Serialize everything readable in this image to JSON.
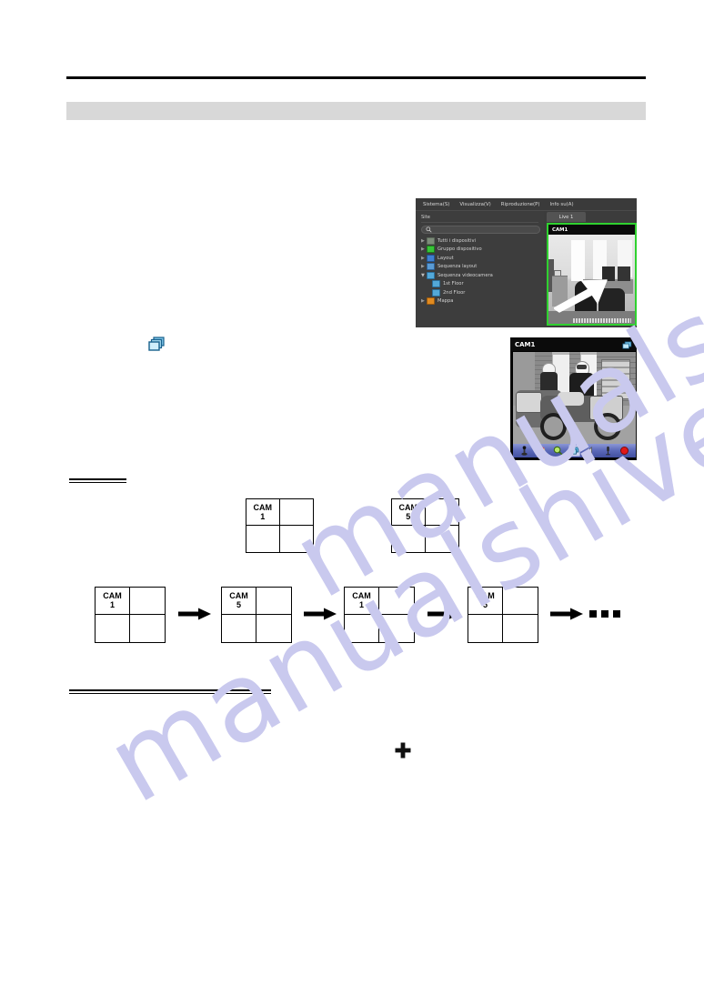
{
  "page": {
    "background": "#ffffff",
    "watermark_text": "manualshive.com",
    "watermark_color": "#c9c9ee"
  },
  "vms_window": {
    "menu": [
      {
        "label": "Sistema(S)"
      },
      {
        "label": "Visualizza(V)"
      },
      {
        "label": "Riproduzione(P)"
      },
      {
        "label": "Info su(A)"
      }
    ],
    "sidebar": {
      "title": "Site",
      "search_placeholder": "",
      "search_icon": "search-icon",
      "tree": [
        {
          "label": "Tutti i dispositivi",
          "icon": "devices-icon",
          "expander": "collapsed",
          "indent": 0
        },
        {
          "label": "Gruppo dispositivo",
          "icon": "device-group-icon",
          "expander": "collapsed",
          "indent": 0
        },
        {
          "label": "Layout",
          "icon": "layout-icon",
          "expander": "collapsed",
          "indent": 0
        },
        {
          "label": "Sequenza layout",
          "icon": "layout-sequence-icon",
          "expander": "collapsed",
          "indent": 0
        },
        {
          "label": "Sequenza videocamera",
          "icon": "camera-sequence-icon",
          "expander": "expanded",
          "indent": 0
        },
        {
          "label": "1st Floor",
          "icon": "camera-sequence-icon",
          "expander": "none",
          "indent": 1
        },
        {
          "label": "2nd Floor",
          "icon": "camera-sequence-icon",
          "expander": "none",
          "indent": 1
        },
        {
          "label": "Mappa",
          "icon": "map-icon",
          "expander": "collapsed",
          "indent": 0
        }
      ]
    },
    "tab_label": "Live  1",
    "video_title": "CAM1",
    "selection_border_color": "#2fd12f"
  },
  "camera_window": {
    "title": "CAM1",
    "corner_icon": "layers-icon",
    "toolbar": [
      {
        "name": "ptz-joystick-icon"
      },
      {
        "name": "color-wheel-icon"
      },
      {
        "name": "zoom-icon"
      },
      {
        "name": "layers-icon",
        "active": true
      },
      {
        "name": "speaker-icon"
      },
      {
        "name": "microphone-icon"
      },
      {
        "name": "record-icon"
      }
    ]
  },
  "inline_icons": {
    "camera_sequence_stack": "layers-icon",
    "plus": "plus-icon"
  },
  "diagrams": {
    "examples_row": [
      {
        "label": "CAM",
        "number": "1"
      },
      {
        "label": "CAM",
        "number": "5"
      }
    ],
    "sequence_row": {
      "steps": [
        {
          "label": "CAM",
          "number": "1"
        },
        {
          "label": "CAM",
          "number": "5"
        },
        {
          "label": "CAM",
          "number": "1"
        },
        {
          "label": "CAM",
          "number": "5"
        }
      ],
      "arrow": "arrow-right-icon",
      "ellipsis": "…"
    }
  }
}
